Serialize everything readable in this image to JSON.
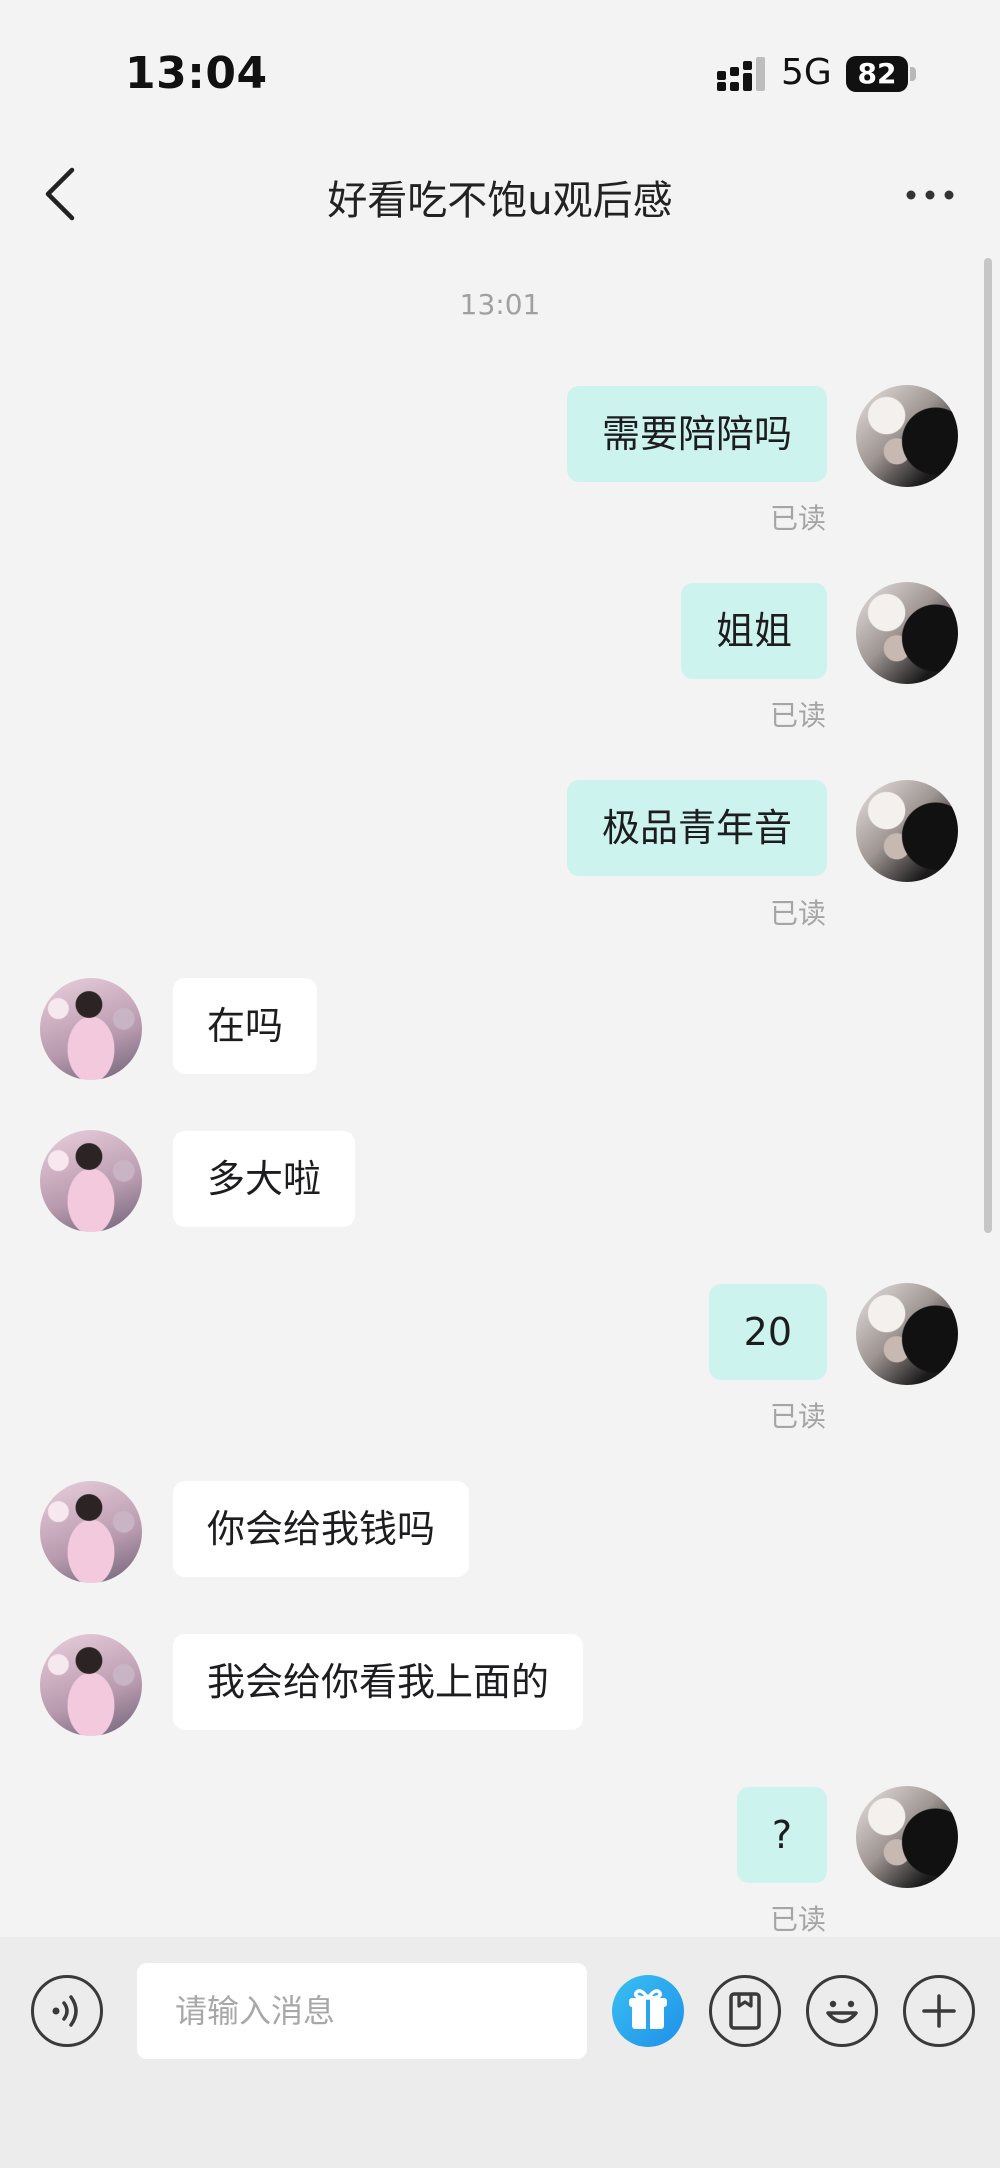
{
  "status_bar": {
    "time": "13:04",
    "network": "5G",
    "battery": "82"
  },
  "header": {
    "title": "好看吃不饱u观后感"
  },
  "chat": {
    "timestamp": "13:01",
    "read_label": "已读",
    "messages": [
      {
        "from": "me",
        "text": "需要陪陪吗",
        "read": true
      },
      {
        "from": "me",
        "text": "姐姐",
        "read": true
      },
      {
        "from": "me",
        "text": "极品青年音",
        "read": true
      },
      {
        "from": "them",
        "text": "在吗"
      },
      {
        "from": "them",
        "text": "多大啦"
      },
      {
        "from": "me",
        "text": "20",
        "read": true
      },
      {
        "from": "them",
        "text": "你会给我钱吗"
      },
      {
        "from": "them",
        "text": "我会给你看我上面的"
      },
      {
        "from": "me",
        "text": "?",
        "read": true
      }
    ]
  },
  "input_bar": {
    "placeholder": "请输入消息"
  },
  "colors": {
    "outgoing_bubble": "#cdf3ee",
    "incoming_bubble": "#ffffff",
    "background": "#f3f3f3",
    "gift_accent": "#1f8fe8"
  }
}
